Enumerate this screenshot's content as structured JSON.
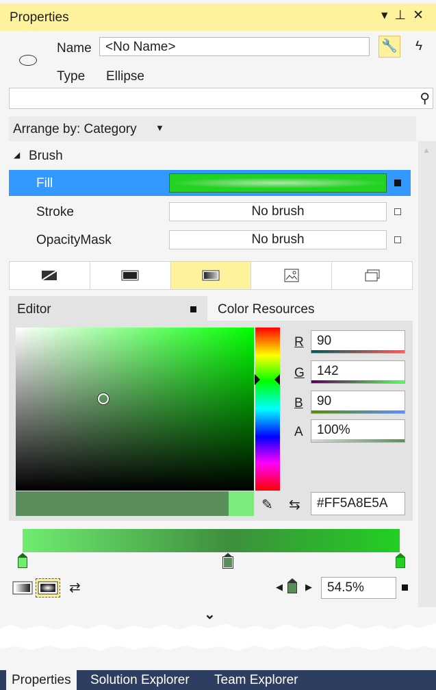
{
  "title": "Properties",
  "header": {
    "name_label": "Name",
    "name_value": "<No Name>",
    "type_label": "Type",
    "type_value": "Ellipse"
  },
  "arrange_by": "Arrange by: Category",
  "category": "Brush",
  "brush_rows": [
    {
      "label": "Fill",
      "value": "",
      "selected": true
    },
    {
      "label": "Stroke",
      "value": "No brush",
      "selected": false
    },
    {
      "label": "OpacityMask",
      "value": "No brush",
      "selected": false
    }
  ],
  "brush_tabs": [
    "no-brush-icon",
    "solid-color-brush-icon",
    "gradient-brush-icon",
    "image-brush-icon",
    "brush-resources-icon"
  ],
  "editor": {
    "tab_editor": "Editor",
    "tab_resources": "Color Resources",
    "r_label": "R",
    "r": "90",
    "g_label": "G",
    "g": "142",
    "b_label": "B",
    "b": "90",
    "a_label": "A",
    "a": "100%",
    "hex": "#FF5A8E5A"
  },
  "gradient": {
    "offset": "54.5%"
  },
  "bottom_tabs": [
    "Properties",
    "Solution Explorer",
    "Team Explorer"
  ],
  "colors": {
    "accent": "#fff29d",
    "selected_row": "#3399ff",
    "current_color": "#5a8e5a"
  }
}
